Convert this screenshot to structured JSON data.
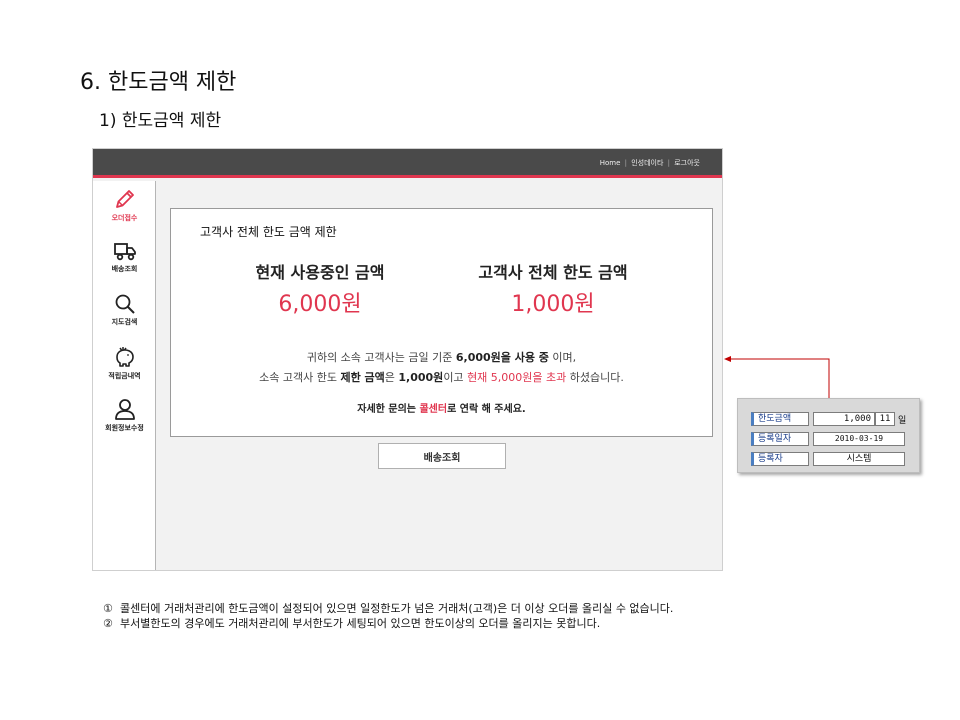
{
  "slide": {
    "title": "6. 한도금액 제한",
    "subtitle": "1) 한도금액 제한"
  },
  "topnav": {
    "home": "Home",
    "sep": "|",
    "company": "인성데이타",
    "logout": "로그아웃"
  },
  "sidebar": {
    "items": [
      {
        "label": "오더접수",
        "icon": "pencil-icon",
        "active": true
      },
      {
        "label": "배송조회",
        "icon": "truck-icon",
        "active": false
      },
      {
        "label": "지도검색",
        "icon": "search-icon",
        "active": false
      },
      {
        "label": "적립금내역",
        "icon": "piggy-bank-icon",
        "active": false
      },
      {
        "label": "회원정보수정",
        "icon": "user-icon",
        "active": false
      }
    ]
  },
  "limit_box": {
    "title": "고객사 전체 한도 금액 제한",
    "current_label": "현재 사용중인 금액",
    "current_value": "6,000원",
    "limit_label": "고객사 전체 한도 금액",
    "limit_value": "1,000원",
    "line1": {
      "p1": "귀하의 소속 고객사는 금일 기준 ",
      "b1": "6,000원을 사용 중",
      "p2": " 이며,"
    },
    "line2": {
      "p1": "소속 고객사 한도 ",
      "b1": "제한 금액",
      "p2": "은 ",
      "b2": "1,000원",
      "p3": "이고 ",
      "r1": "현재 5,000원을 초과",
      "p4": " 하셨습니다."
    },
    "line3": {
      "p1": "자세한 문의는 ",
      "r1": "콜센터",
      "p2": "로 연락 해 주세요."
    }
  },
  "delivery_button": "배송조회",
  "inset": {
    "rows": [
      {
        "label": "한도금액",
        "value": "1,000",
        "extra": "11",
        "unit": "일"
      },
      {
        "label": "등록일자",
        "value": "2010-03-19"
      },
      {
        "label": "등록자",
        "value": "시스템"
      }
    ]
  },
  "notes": [
    {
      "num": "①",
      "text": "콜센터에 거래처관리에 한도금액이 설정되어 있으면 일정한도가 넘은 거래처(고객)은 더 이상 오더를 올리실 수 없습니다."
    },
    {
      "num": "②",
      "text": "부서별한도의 경우에도 거래처관리에 부서한도가 세팅되어 있으면 한도이상의 오더를 올리지는 못합니다."
    }
  ],
  "colors": {
    "accent": "#e0364f",
    "topbar": "#4a4a4a",
    "content_bg": "#f2f2f2",
    "callout_line": "#c00000",
    "inset_label_text": "#1a3d8a"
  }
}
